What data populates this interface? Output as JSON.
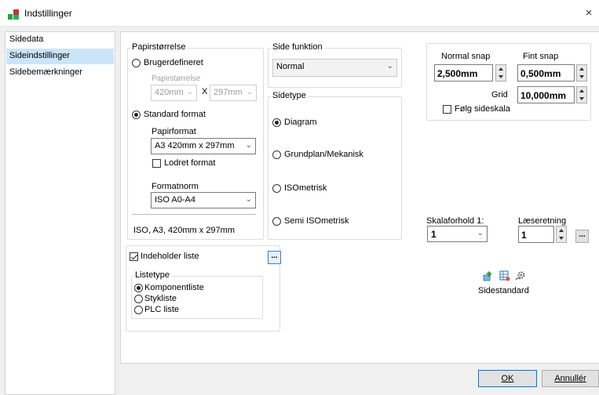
{
  "window": {
    "title": "Indstillinger",
    "close_glyph": "×"
  },
  "sidebar": {
    "items": [
      {
        "label": "Sidedata"
      },
      {
        "label": "Sideindstillinger"
      },
      {
        "label": "Sidebemærkninger"
      }
    ]
  },
  "paper": {
    "group_title": "Papirstørrelse",
    "custom_label": "Brugerdefineret",
    "custom_size_label": "Papirstørrelse",
    "custom_width": "420mm",
    "times": "X",
    "custom_height": "297mm",
    "standard_label": "Standard format",
    "paperformat_label": "Papirformat",
    "paperformat_value": "A3    420mm x 297mm",
    "portrait_label": "Lodret format",
    "norm_label": "Formatnorm",
    "norm_value": "ISO A0-A4",
    "summary": "ISO, A3, 420mm x 297mm"
  },
  "page_function": {
    "group_title": "Side funktion",
    "value": "Normal"
  },
  "page_type": {
    "group_title": "Sidetype",
    "options": [
      {
        "label": "Diagram",
        "selected": true
      },
      {
        "label": "Grundplan/Mekanisk",
        "selected": false
      },
      {
        "label": "ISOmetrisk",
        "selected": false
      },
      {
        "label": "Semi ISOmetrisk",
        "selected": false
      }
    ]
  },
  "snap": {
    "normal_label": "Normal snap",
    "normal_value": "2,500mm",
    "fine_label": "Fint snap",
    "fine_value": "0,500mm",
    "grid_label": "Grid",
    "grid_value": "10,000mm",
    "follow_scale_label": "Følg sideskala"
  },
  "scale": {
    "label": "Skalaforhold 1:",
    "value": "1"
  },
  "reading": {
    "label": "Læseretning",
    "value": "1",
    "more": "..."
  },
  "list": {
    "contains_label": "Indeholder liste",
    "more": "...",
    "type_title": "Listetype",
    "options": [
      {
        "label": "Komponentliste",
        "selected": true
      },
      {
        "label": "Stykliste",
        "selected": false
      },
      {
        "label": "PLC liste",
        "selected": false
      }
    ]
  },
  "page_standard": {
    "label": "Sidestandard",
    "icons": [
      "upload-icon",
      "table-settings-icon",
      "gear-link-icon"
    ]
  },
  "footer": {
    "ok": "OK",
    "cancel": "Annullér"
  }
}
